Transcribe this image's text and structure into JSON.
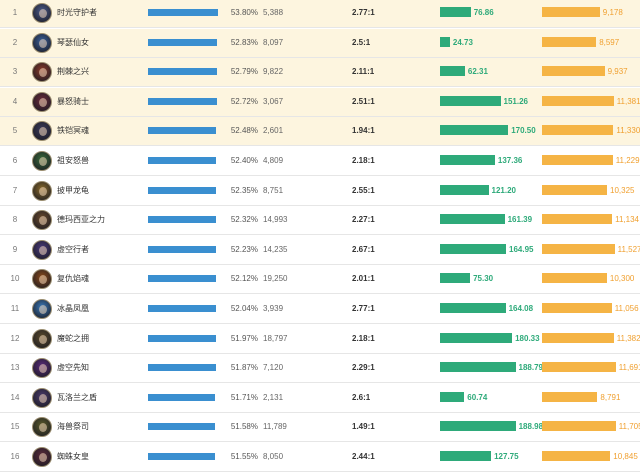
{
  "colors": {
    "top_row_bg": "#fdf5df",
    "win_rate_bar": "#3a8fd0",
    "damage_bar": "#2eaa7a",
    "gold_bar": "#f5b445",
    "gold_text": "#f0a030"
  },
  "rows": [
    {
      "rank": "1",
      "name": "时光守护者",
      "win_rate": "53.80%",
      "win_rate_value": 53.8,
      "games": "5,388",
      "kda": "2.77:1",
      "damage": "76.86",
      "damage_value": 76.86,
      "gold": "9,178",
      "gold_value": 9178,
      "avatar_color": "#4a5a8a",
      "highlight": true
    },
    {
      "rank": "2",
      "name": "琴瑟仙女",
      "win_rate": "52.83%",
      "win_rate_value": 52.83,
      "games": "8,097",
      "kda": "2.5:1",
      "damage": "24.73",
      "damage_value": 24.73,
      "gold": "8,597",
      "gold_value": 8597,
      "avatar_color": "#3a5f9a",
      "highlight": true
    },
    {
      "rank": "3",
      "name": "荆棘之兴",
      "win_rate": "52.79%",
      "win_rate_value": 52.79,
      "games": "9,822",
      "kda": "2.11:1",
      "damage": "62.31",
      "damage_value": 62.31,
      "gold": "9,937",
      "gold_value": 9937,
      "avatar_color": "#8a3a2a",
      "highlight": true
    },
    {
      "rank": "4",
      "name": "暴怒骑士",
      "win_rate": "52.72%",
      "win_rate_value": 52.72,
      "games": "3,067",
      "kda": "2.51:1",
      "damage": "151.26",
      "damage_value": 151.26,
      "gold": "11,381",
      "gold_value": 11381,
      "avatar_color": "#6a2a3a",
      "highlight": true
    },
    {
      "rank": "5",
      "name": "铁铠冥魂",
      "win_rate": "52.48%",
      "win_rate_value": 52.48,
      "games": "2,601",
      "kda": "1.94:1",
      "damage": "170.50",
      "damage_value": 170.5,
      "gold": "11,330",
      "gold_value": 11330,
      "avatar_color": "#3a3a5a",
      "highlight": true
    },
    {
      "rank": "6",
      "name": "祖安怒兽",
      "win_rate": "52.40%",
      "win_rate_value": 52.4,
      "games": "4,809",
      "kda": "2.18:1",
      "damage": "137.36",
      "damage_value": 137.36,
      "gold": "11,229",
      "gold_value": 11229,
      "avatar_color": "#3a6a3a",
      "highlight": false
    },
    {
      "rank": "7",
      "name": "披甲龙龟",
      "win_rate": "52.35%",
      "win_rate_value": 52.35,
      "games": "8,751",
      "kda": "2.55:1",
      "damage": "121.20",
      "damage_value": 121.2,
      "gold": "10,325",
      "gold_value": 10325,
      "avatar_color": "#8a6a2a",
      "highlight": false
    },
    {
      "rank": "8",
      "name": "德玛西亚之力",
      "win_rate": "52.32%",
      "win_rate_value": 52.32,
      "games": "14,993",
      "kda": "2.27:1",
      "damage": "161.39",
      "damage_value": 161.39,
      "gold": "11,134",
      "gold_value": 11134,
      "avatar_color": "#6a4a2a",
      "highlight": false
    },
    {
      "rank": "9",
      "name": "虚空行者",
      "win_rate": "52.23%",
      "win_rate_value": 52.23,
      "games": "14,235",
      "kda": "2.67:1",
      "damage": "164.95",
      "damage_value": 164.95,
      "gold": "11,527",
      "gold_value": 11527,
      "avatar_color": "#4a3a7a",
      "highlight": false
    },
    {
      "rank": "10",
      "name": "复仇焰魂",
      "win_rate": "52.12%",
      "win_rate_value": 52.12,
      "games": "19,250",
      "kda": "2.01:1",
      "damage": "75.30",
      "damage_value": 75.3,
      "gold": "10,300",
      "gold_value": 10300,
      "avatar_color": "#8a4a1a",
      "highlight": false
    },
    {
      "rank": "11",
      "name": "冰晶凤凰",
      "win_rate": "52.04%",
      "win_rate_value": 52.04,
      "games": "3,939",
      "kda": "2.77:1",
      "damage": "164.08",
      "damage_value": 164.08,
      "gold": "11,056",
      "gold_value": 11056,
      "avatar_color": "#3a7aba",
      "highlight": false
    },
    {
      "rank": "12",
      "name": "魔蛇之拥",
      "win_rate": "51.97%",
      "win_rate_value": 51.97,
      "games": "18,797",
      "kda": "2.18:1",
      "damage": "180.33",
      "damage_value": 180.33,
      "gold": "11,382",
      "gold_value": 11382,
      "avatar_color": "#5a4a2a",
      "highlight": false
    },
    {
      "rank": "13",
      "name": "虚空先知",
      "win_rate": "51.87%",
      "win_rate_value": 51.87,
      "games": "7,120",
      "kda": "2.29:1",
      "damage": "188.79",
      "damage_value": 188.79,
      "gold": "11,691",
      "gold_value": 11691,
      "avatar_color": "#5a2a7a",
      "highlight": false
    },
    {
      "rank": "14",
      "name": "瓦洛兰之盾",
      "win_rate": "51.71%",
      "win_rate_value": 51.71,
      "games": "2,131",
      "kda": "2.6:1",
      "damage": "60.74",
      "damage_value": 60.74,
      "gold": "8,791",
      "gold_value": 8791,
      "avatar_color": "#4a3a6a",
      "highlight": false
    },
    {
      "rank": "15",
      "name": "海兽祭司",
      "win_rate": "51.58%",
      "win_rate_value": 51.58,
      "games": "11,789",
      "kda": "1.49:1",
      "damage": "188.98",
      "damage_value": 188.98,
      "gold": "11,705",
      "gold_value": 11705,
      "avatar_color": "#5a5a2a",
      "highlight": false
    },
    {
      "rank": "16",
      "name": "蜘蛛女皇",
      "win_rate": "51.55%",
      "win_rate_value": 51.55,
      "games": "8,050",
      "kda": "2.44:1",
      "damage": "127.75",
      "damage_value": 127.75,
      "gold": "10,845",
      "gold_value": 10845,
      "avatar_color": "#5a2a3a",
      "highlight": false
    }
  ]
}
